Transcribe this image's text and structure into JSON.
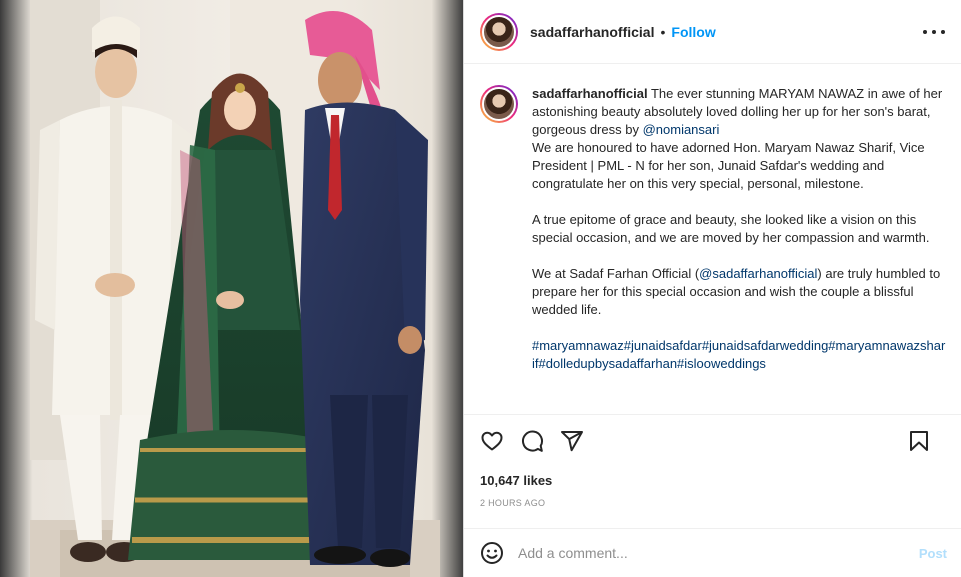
{
  "post": {
    "username": "sadaffarhanofficial",
    "separator": "•",
    "follow_label": "Follow"
  },
  "caption": {
    "username": "sadaffarhanofficial",
    "line1": "The ever stunning MARYAM NAWAZ in awe of her astonishing beauty absolutely loved dolling her up for her son's barat, gorgeous dress by ",
    "mention_dress": "@nomiansari",
    "line2": "We are honoured to have adorned Hon. Maryam Nawaz Sharif, Vice President | PML - N for her son, Junaid Safdar's wedding and congratulate her on this very special, personal, milestone.",
    "para2": "A true epitome of grace and beauty, she looked like a vision on this special occasion, and we are moved by her compassion and warmth.",
    "para3_start": "We at Sadaf Farhan Official (",
    "mention_self": "@sadaffarhanofficial",
    "para3_end": ") are truly humbled to prepare her for this special occasion and wish the couple a blissful wedded life.",
    "hashtags": "#maryamnawaz#junaidsafdar#junaidsafdarwedding#maryamnawazsharif#dolledupbysadaffarhan#islooweddings"
  },
  "actions": {
    "like": "heart-icon",
    "comment": "comment-icon",
    "share": "share-icon",
    "save": "bookmark-icon"
  },
  "likes": "10,647 likes",
  "timestamp": "2 HOURS AGO",
  "comment_box": {
    "placeholder": "Add a comment...",
    "post_label": "Post"
  },
  "colors": {
    "accent": "#0095f6",
    "link": "#00376b",
    "post_disabled": "#b2dffc"
  }
}
